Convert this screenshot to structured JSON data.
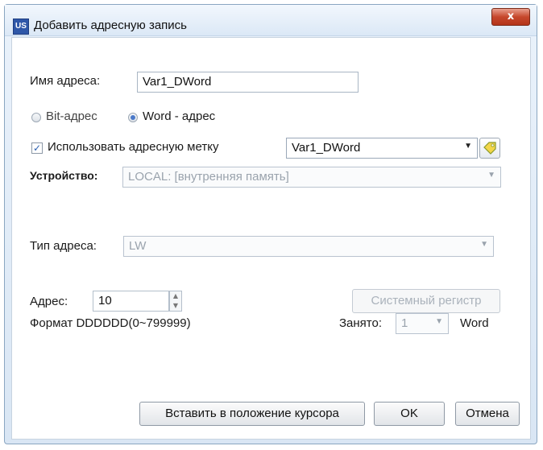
{
  "window": {
    "app_icon": "US",
    "title": "Добавить адресную запись",
    "close_glyph": "x"
  },
  "form": {
    "address_name_label": "Имя адреса:",
    "address_name_value": "Var1_DWord",
    "bit_address_label": "Bit-адрес",
    "word_address_label": "Word - адрес",
    "selected_address_kind": "word",
    "use_tag_label": "Использовать адресную метку",
    "use_tag_checked": true,
    "tag_value": "Var1_DWord",
    "device_label": "Устройство:",
    "device_value": "LOCAL: [внутренняя память]",
    "address_type_label": "Тип адреса:",
    "address_type_value": "LW",
    "address_label": "Адрес:",
    "address_value": "10",
    "format_label": "Формат DDDDDD(0~799999)",
    "system_register_button": "Системный регистр",
    "occupied_label": "Занято:",
    "occupied_value": "1",
    "occupied_unit": "Word"
  },
  "buttons": {
    "insert_at_cursor": "Вставить в положение курсора",
    "ok": "OK",
    "cancel": "Отмена"
  },
  "icons": {
    "tag": "tag-icon",
    "dropdown": "chevron-down-icon",
    "spin": "spin-arrows-icon"
  }
}
